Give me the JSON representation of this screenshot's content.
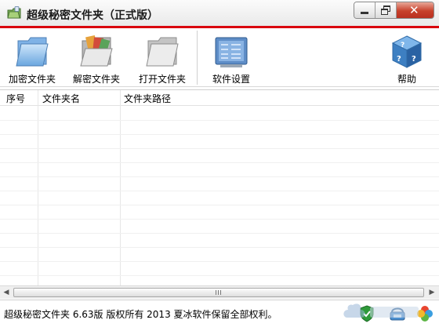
{
  "window": {
    "title": "超级秘密文件夹（正式版）",
    "controls": {
      "minimize": "minimize",
      "restore": "restore",
      "close": "✕"
    }
  },
  "toolbar": {
    "items": [
      {
        "label": "加密文件夹",
        "icon": "folder-lock-icon"
      },
      {
        "label": "解密文件夹",
        "icon": "folder-open-icon"
      },
      {
        "label": "打开文件夹",
        "icon": "folder-icon"
      },
      {
        "label": "软件设置",
        "icon": "settings-panel-icon"
      },
      {
        "label": "帮助",
        "icon": "help-cube-icon"
      }
    ]
  },
  "list": {
    "columns": [
      "序号",
      "文件夹名",
      "文件夹路径"
    ],
    "rows": []
  },
  "scrollbar": {
    "left_arrow": "◀",
    "right_arrow": "▶"
  },
  "status": {
    "text": "超级秘密文件夹 6.63版 版权所有 2013 夏冰软件保留全部权利。",
    "icons": [
      "shield-icon",
      "phone-icon",
      "clover-icon"
    ]
  },
  "colors": {
    "accent": "#d9000d",
    "title_gradient_top": "#fbfbfb",
    "close_button": "#c7412b"
  }
}
